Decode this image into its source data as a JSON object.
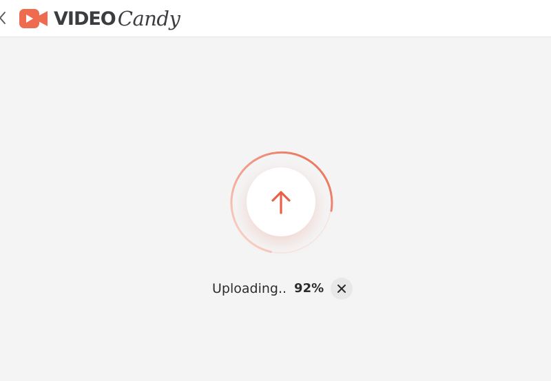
{
  "header": {
    "logo": {
      "word_video": "VIDEO",
      "word_candy": "Candy",
      "mark_icon": "video-camera-icon",
      "brand_color": "#ef6b4f"
    },
    "back_icon": "chevron-left-icon"
  },
  "upload": {
    "icon": "arrow-up-icon",
    "progress": 0.92,
    "accent_color": "#ea6a4e",
    "status_label": "Uploading..",
    "percent_text": "92%",
    "cancel_icon": "close-icon"
  }
}
